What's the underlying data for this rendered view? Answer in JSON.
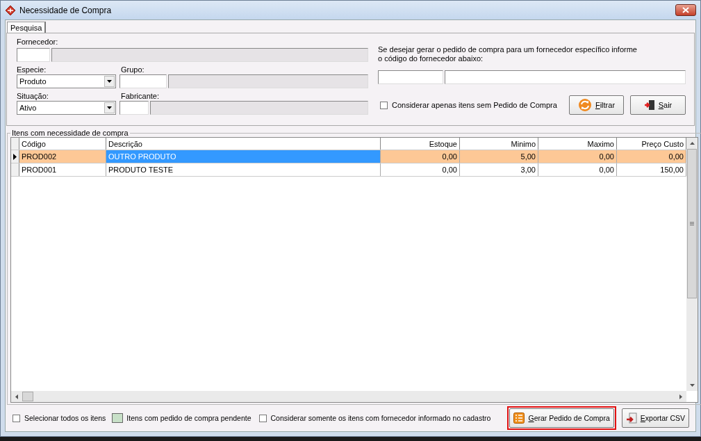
{
  "window": {
    "title": "Necessidade de Compra"
  },
  "tabs": [
    {
      "label": "Pesquisa",
      "selected": true
    }
  ],
  "filters": {
    "fornecedor": {
      "label": "Fornecedor:"
    },
    "especie": {
      "label": "Especie:",
      "value": "Produto"
    },
    "grupo": {
      "label": "Grupo:"
    },
    "situacao": {
      "label": "Situação:",
      "value": "Ativo"
    },
    "fabricante": {
      "label": "Fabricante:"
    }
  },
  "supplier_hint": "Se desejar gerar o pedido de compra para um fornecedor específico informe o código do fornecedor abaixo:",
  "only_without_order": {
    "label": "Considerar apenas itens sem Pedido de Compra",
    "checked": false
  },
  "search_buttons": [
    {
      "label": "Filtrar",
      "kind": "filter"
    },
    {
      "label": "Sair",
      "kind": "exit"
    }
  ],
  "group_title": "Itens com necessidade de compra",
  "table": {
    "columns": [
      {
        "label": "Código",
        "numeric": false
      },
      {
        "label": "Descrição",
        "numeric": false
      },
      {
        "label": "Estoque",
        "numeric": true
      },
      {
        "label": "Minimo",
        "numeric": true
      },
      {
        "label": "Maximo",
        "numeric": true
      },
      {
        "label": "Preço Custo",
        "numeric": true
      }
    ],
    "rows": [
      {
        "selected": true,
        "cells": [
          {
            "text": "PROD002",
            "focused": false
          },
          {
            "text": "OUTRO PRODUTO",
            "focused": true
          },
          {
            "text": "0,00",
            "focused": false
          },
          {
            "text": "5,00",
            "focused": false
          },
          {
            "text": "0,00",
            "focused": false
          },
          {
            "text": "0,00",
            "focused": false
          }
        ]
      },
      {
        "selected": false,
        "cells": [
          {
            "text": "PROD001",
            "focused": false
          },
          {
            "text": "PRODUTO TESTE",
            "focused": false
          },
          {
            "text": "0,00",
            "focused": false
          },
          {
            "text": "3,00",
            "focused": false
          },
          {
            "text": "0,00",
            "focused": false
          },
          {
            "text": "150,00",
            "focused": false
          }
        ]
      }
    ]
  },
  "footer": {
    "select_all": {
      "label": "Selecionar todos os itens",
      "checked": false
    },
    "legend": {
      "label": "Itens com pedido de compra pendente",
      "color": "#c8e0c8"
    },
    "supplier_only": {
      "label": "Considerar somente os itens com fornecedor informado no cadastro",
      "checked": false
    },
    "buttons": [
      {
        "label": "Gerar Pedido de Compra",
        "kind": "generate",
        "highlighted": true
      },
      {
        "label": "Exportar CSV",
        "kind": "export",
        "highlighted": false
      }
    ]
  }
}
